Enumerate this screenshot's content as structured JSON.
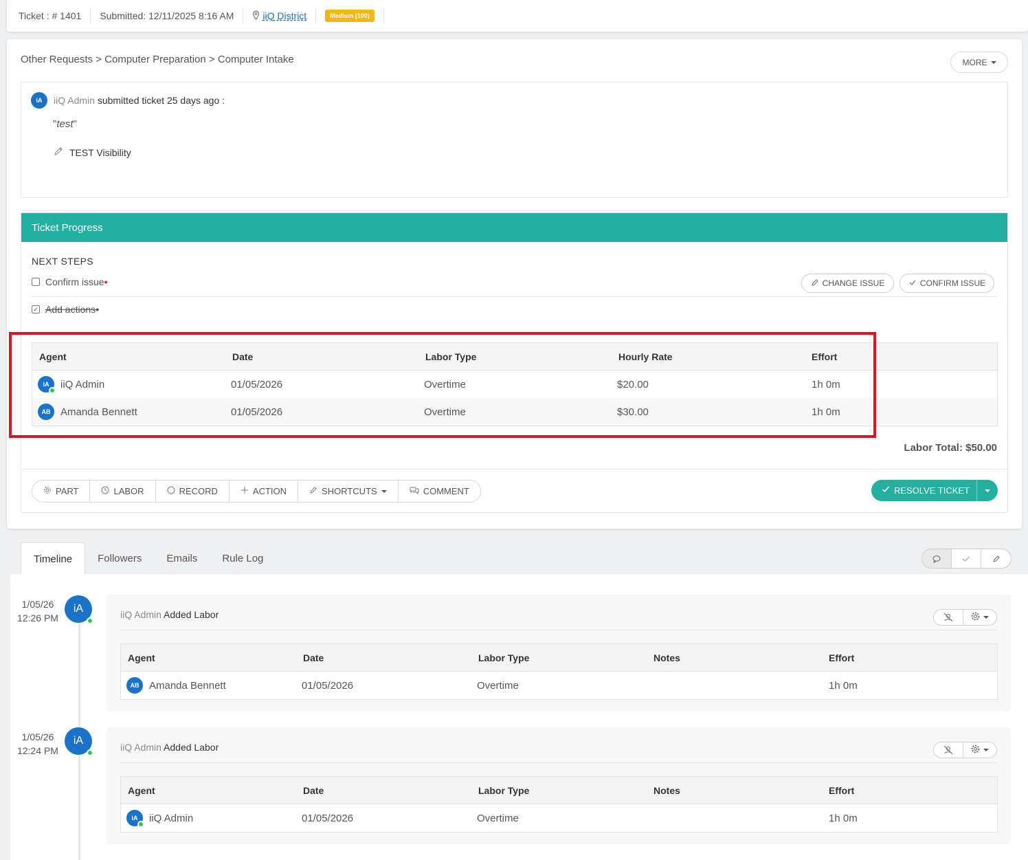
{
  "topbar": {
    "ticket": "Ticket : # 1401",
    "submitted": "Submitted: 12/11/2025 8:16 AM",
    "location": "iiQ District",
    "priority": "Medium (100)",
    "priority_color": "#f5b41a"
  },
  "breadcrumb": "Other Requests > Computer Preparation > Computer Intake",
  "more_label": "MORE",
  "submission": {
    "avatar_initials": "iA",
    "user": "iiQ Admin",
    "text": "submitted ticket 25 days ago :",
    "quote": "test",
    "visibility": "TEST Visibility"
  },
  "progress": {
    "title": "Ticket Progress",
    "header_color": "#23b0a0",
    "next_steps_label": "NEXT STEPS",
    "steps": [
      {
        "label": "Confirm issue",
        "done": false
      },
      {
        "label": "Add actions",
        "done": true
      }
    ],
    "change_issue_label": "CHANGE ISSUE",
    "confirm_issue_label": "CONFIRM ISSUE"
  },
  "labor_table": {
    "headers": [
      "Agent",
      "Date",
      "Labor Type",
      "Hourly Rate",
      "Effort"
    ],
    "rows": [
      {
        "initials": "iA",
        "agent": "iiQ Admin",
        "date": "01/05/2026",
        "type": "Overtime",
        "rate": "$20.00",
        "effort": "1h 0m",
        "online": true
      },
      {
        "initials": "AB",
        "agent": "Amanda Bennett",
        "date": "01/05/2026",
        "type": "Overtime",
        "rate": "$30.00",
        "effort": "1h 0m",
        "online": false
      }
    ],
    "total": "Labor Total: $50.00"
  },
  "actions": {
    "part": "PART",
    "labor": "LABOR",
    "record": "RECORD",
    "action": "ACTION",
    "shortcuts": "SHORTCUTS",
    "comment": "COMMENT",
    "resolve": "RESOLVE TICKET"
  },
  "tabs": [
    "Timeline",
    "Followers",
    "Emails",
    "Rule Log"
  ],
  "timeline": [
    {
      "date": "1/05/26",
      "time": "12:26 PM",
      "initials": "iA",
      "user": "iiQ Admin",
      "action": "Added Labor",
      "headers": [
        "Agent",
        "Date",
        "Labor Type",
        "Notes",
        "Effort"
      ],
      "row": {
        "initials": "AB",
        "agent": "Amanda Bennett",
        "date": "01/05/2026",
        "type": "Overtime",
        "notes": "",
        "effort": "1h 0m"
      }
    },
    {
      "date": "1/05/26",
      "time": "12:24 PM",
      "initials": "iA",
      "user": "iiQ Admin",
      "action": "Added Labor",
      "headers": [
        "Agent",
        "Date",
        "Labor Type",
        "Notes",
        "Effort"
      ],
      "row": {
        "initials": "iA",
        "agent": "iiQ Admin",
        "date": "01/05/2026",
        "type": "Overtime",
        "notes": "",
        "effort": "1h 0m"
      }
    }
  ]
}
